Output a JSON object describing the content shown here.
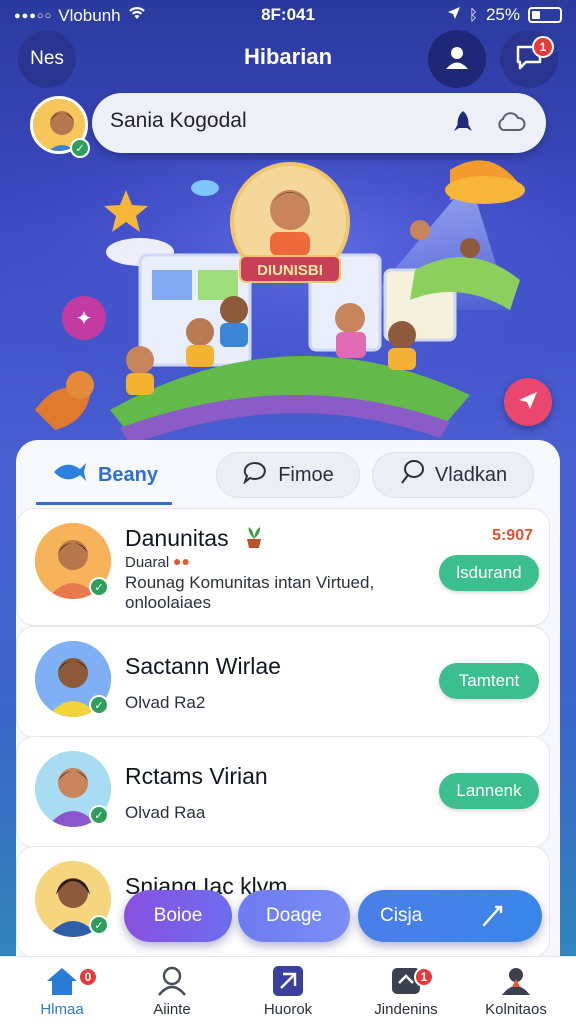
{
  "status_bar": {
    "carrier": "Vlobunh",
    "time": "8F:041",
    "battery": "25%"
  },
  "header": {
    "left_label": "Nes",
    "title": "Hibarian",
    "chat_badge": "1"
  },
  "search": {
    "value": "Sania Kogodal"
  },
  "hero": {
    "banner_text": "DIUNISBI"
  },
  "tabs": [
    {
      "label": "Beany"
    },
    {
      "label": "Fimoe"
    },
    {
      "label": "Vladkan"
    }
  ],
  "list": [
    {
      "name": "Danunitas",
      "meta": "Duaral",
      "time": "5:907",
      "line1": "Rounag Komunitas intan Virtued,",
      "line2": "onloolaiaes",
      "action": "lsdurand"
    },
    {
      "name": "Sactann Wirlae",
      "line1": "Olvad Ra2",
      "action": "Tamtent"
    },
    {
      "name": "Rctams Virian",
      "line1": "Olvad Raa",
      "action": "Lannenk"
    },
    {
      "name": "Sniang Iac klym"
    }
  ],
  "floating_actions": [
    {
      "label": "Boioe"
    },
    {
      "label": "Doage"
    },
    {
      "label": "Cisja"
    }
  ],
  "bottom_nav": [
    {
      "label": "Hlmaa",
      "badge": "0"
    },
    {
      "label": "Aiinte"
    },
    {
      "label": "Huorok"
    },
    {
      "label": "Jindenins",
      "badge": "1"
    },
    {
      "label": "Kolnitaos"
    }
  ],
  "colors": {
    "primary": "#2f6fd1",
    "accent_green": "#3bbf8f",
    "badge_red": "#e43a3a"
  }
}
